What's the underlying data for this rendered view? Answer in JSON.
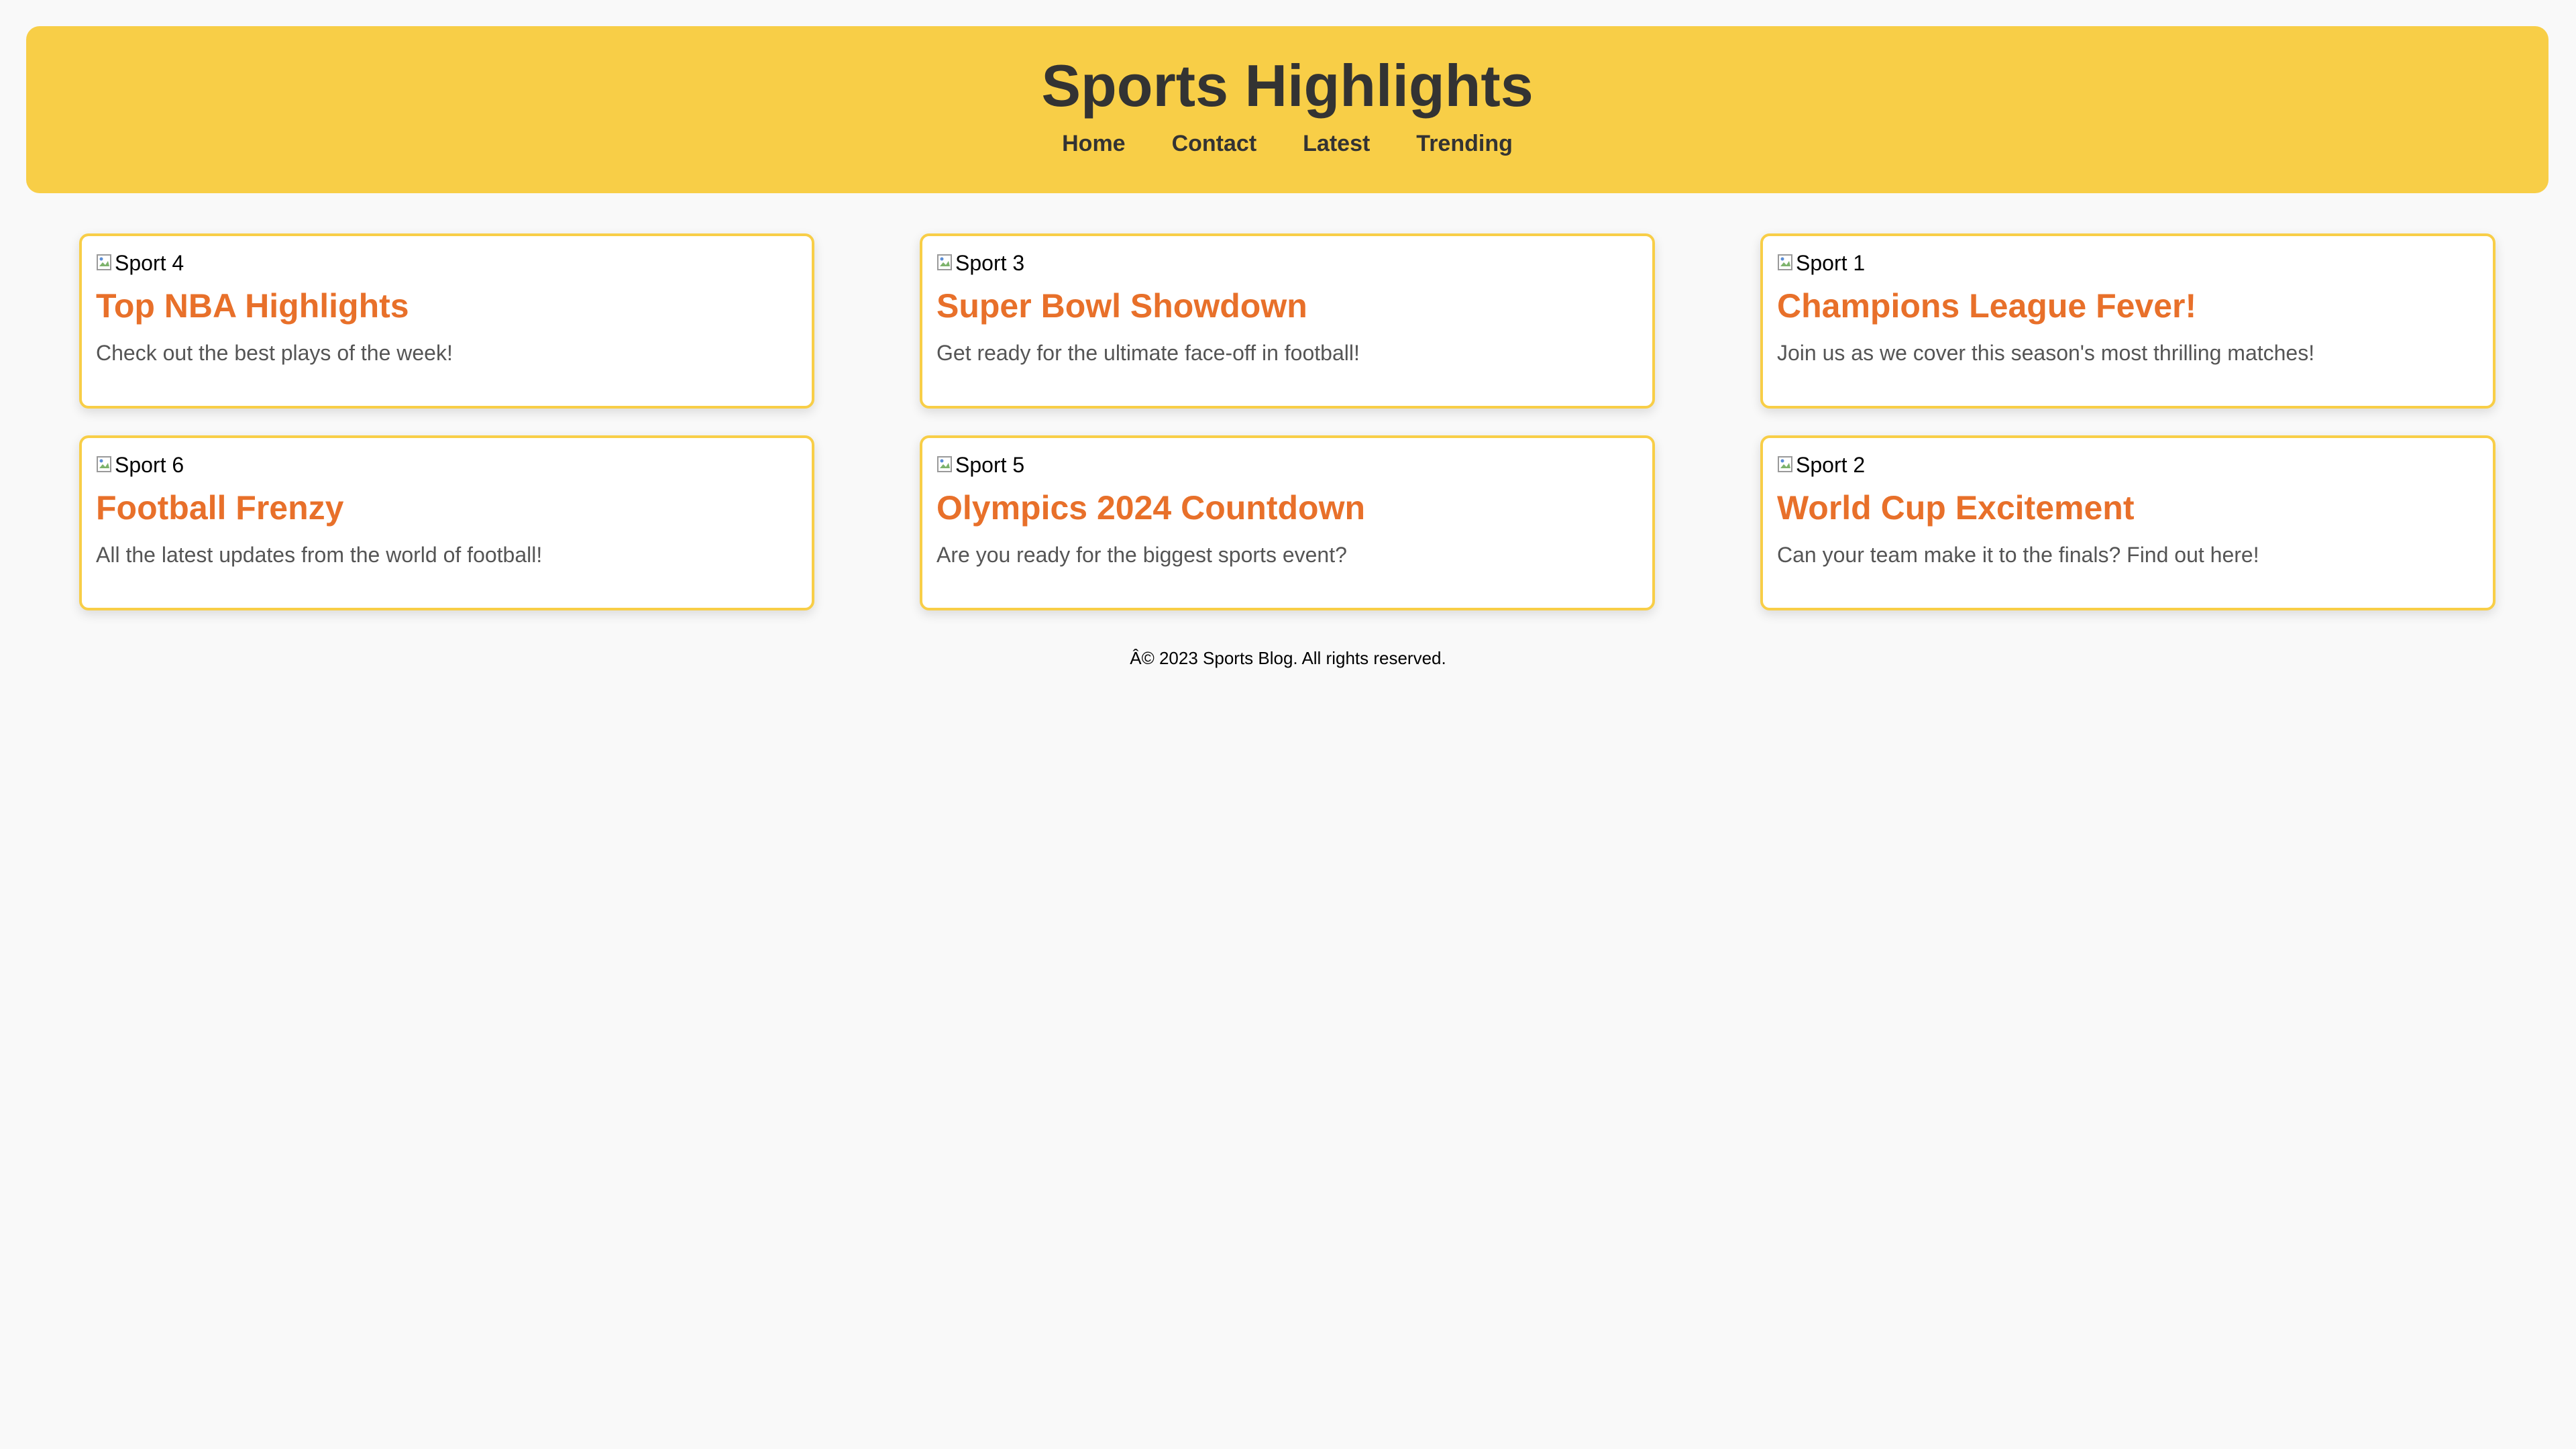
{
  "header": {
    "title": "Sports Highlights",
    "nav": [
      "Home",
      "Contact",
      "Latest",
      "Trending"
    ]
  },
  "cards": [
    {
      "image_alt": "Sport 4",
      "title": "Top NBA Highlights",
      "text": "Check out the best plays of the week!"
    },
    {
      "image_alt": "Sport 3",
      "title": "Super Bowl Showdown",
      "text": "Get ready for the ultimate face-off in football!"
    },
    {
      "image_alt": "Sport 1",
      "title": "Champions League Fever!",
      "text": "Join us as we cover this season's most thrilling matches!"
    },
    {
      "image_alt": "Sport 6",
      "title": "Football Frenzy",
      "text": "All the latest updates from the world of football!"
    },
    {
      "image_alt": "Sport 5",
      "title": "Olympics 2024 Countdown",
      "text": "Are you ready for the biggest sports event?"
    },
    {
      "image_alt": "Sport 2",
      "title": "World Cup Excitement",
      "text": "Can your team make it to the finals? Find out here!"
    }
  ],
  "footer": {
    "text": "Â© 2023 Sports Blog. All rights reserved."
  },
  "colors": {
    "header_bg": "#f8ce47",
    "card_border": "#f8ce47",
    "card_title": "#e8702a",
    "title_text": "#333333",
    "page_bg": "#f9f9f9"
  },
  "icons": {
    "card_image": "broken-image-icon"
  }
}
